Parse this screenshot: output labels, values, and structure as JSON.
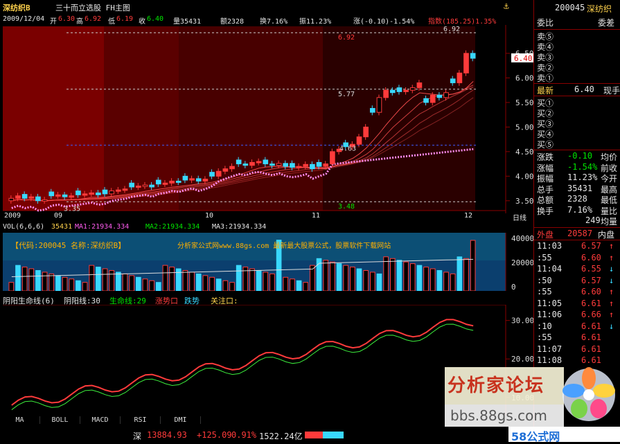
{
  "header": {
    "stock": "深纺织B",
    "title": "三十而立选股 FH主图"
  },
  "info": {
    "date": "2009/12/04",
    "open_l": "开",
    "open": "6.30",
    "high_l": "高",
    "high": "6.92",
    "low_l": "低",
    "low": "6.19",
    "close_l": "收",
    "close": "6.40",
    "vol": "量35431",
    "amt": "额2328",
    "turn": "换7.16%",
    "amp": "振11.23%",
    "chg": "涨(-0.10)-1.54%",
    "idx": "指数(185.25)1.35%"
  },
  "main": {
    "price_labels": [
      "6.92",
      "5.77",
      "4.63",
      "3.48",
      "3.35",
      "6.92"
    ],
    "yticks": [
      "6.50",
      "6.00",
      "5.50",
      "5.00",
      "4.50",
      "4.00",
      "3.50"
    ],
    "cur": "6.40",
    "xlabels": [
      "2009",
      "09",
      "10",
      "11",
      "12"
    ],
    "rt": "日线"
  },
  "vol": {
    "hdr": "VOL(6,6,6)",
    "v": "35431",
    "ma1": "MA1:21934.334",
    "ma2": "MA2:21934.334",
    "ma3": "MA3:21934.334",
    "ad1": "【代码:200045 名称:深纺织B】",
    "ad2": "分析家公式网www.88gs.com 最新最大股票公式，股票软件下载网站",
    "yticks": [
      "40000",
      "20000",
      "0"
    ]
  },
  "yy": {
    "name": "阴阳生命线(6)",
    "yyl": "阴阳线:30",
    "sml": "生命线:29",
    "zs": "涨势口",
    "ds": "跌势",
    "gz": "关注口:",
    "yticks": [
      "30.00",
      "20.00",
      "10.00"
    ]
  },
  "tabs": [
    "MA",
    "BOLL",
    "MACD",
    "RSI",
    "DMI"
  ],
  "status": {
    "mkt": "深",
    "idx": "13884.93",
    "chg": "+125.09",
    "pct": "0.91%",
    "amt": "1522.24亿"
  },
  "right": {
    "code": "200045",
    "name": "深纺织",
    "wb": "委比",
    "wc": "委差",
    "sells": [
      "卖⑤",
      "卖④",
      "卖③",
      "卖②",
      "卖①"
    ],
    "last_l": "最新",
    "last": "6.40",
    "xs": "现手",
    "buys": [
      "买①",
      "买②",
      "买③",
      "买④",
      "买⑤"
    ],
    "rows": [
      {
        "l": "涨跌",
        "v": "-0.10",
        "r": "均价"
      },
      {
        "l": "涨幅",
        "v": "-1.54%",
        "r": "前收"
      },
      {
        "l": "振幅",
        "v": "11.23%",
        "r": "今开"
      },
      {
        "l": "总手",
        "v": "35431",
        "r": "最高"
      },
      {
        "l": "总额",
        "v": "2328",
        "r": "最低"
      },
      {
        "l": "换手",
        "v": "7.16%",
        "r": "量比"
      },
      {
        "l": "",
        "v": "249",
        "r": "均量"
      }
    ],
    "wp": "外盘",
    "wpv": "20587",
    "np": "内盘",
    "ticks": [
      {
        "t": "11:03",
        "p": "6.57",
        "a": "↑"
      },
      {
        "t": ":55",
        "p": "6.60",
        "a": "↑"
      },
      {
        "t": "11:04",
        "p": "6.55",
        "a": "↓"
      },
      {
        "t": ":50",
        "p": "6.57",
        "a": "↓"
      },
      {
        "t": ":55",
        "p": "6.60",
        "a": "↑"
      },
      {
        "t": "11:05",
        "p": "6.61",
        "a": "↑"
      },
      {
        "t": "11:06",
        "p": "6.66",
        "a": "↑"
      },
      {
        "t": ":10",
        "p": "6.61",
        "a": "↓"
      },
      {
        "t": ":55",
        "p": "6.61",
        "a": ""
      },
      {
        "t": "11:07",
        "p": "6.61",
        "a": ""
      },
      {
        "t": "11:08",
        "p": "6.61",
        "a": ""
      }
    ]
  },
  "wm": {
    "title": "分析家论坛",
    "url": "bbs.88gs.com",
    "brand": "58公式网"
  }
}
